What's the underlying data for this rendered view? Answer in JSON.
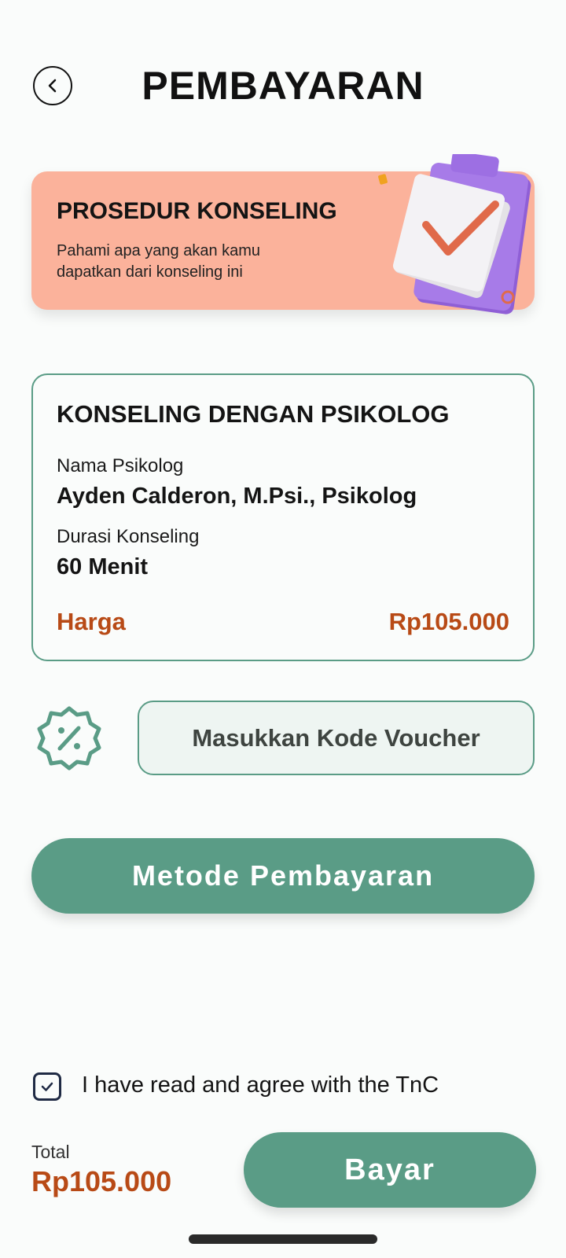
{
  "header": {
    "title": "PEMBAYARAN",
    "back_icon": "chevron-left-icon"
  },
  "banner": {
    "title": "PROSEDUR KONSELING",
    "subtitle": "Pahami apa yang akan kamu dapatkan dari konseling ini",
    "illustration": "clipboard-checklist-icon",
    "background": "#fbb29b"
  },
  "card": {
    "title": "KONSELING DENGAN PSIKOLOG",
    "psychologist_label": "Nama Psikolog",
    "psychologist_name": "Ayden Calderon, M.Psi., Psikolog",
    "duration_label": "Durasi Konseling",
    "duration_value": "60 Menit",
    "price_label": "Harga",
    "price_value": "Rp105.000",
    "border_color": "#5a9c86"
  },
  "voucher": {
    "icon": "discount-badge-icon",
    "placeholder": "Masukkan Kode Voucher"
  },
  "payment_method": {
    "label": "Metode Pembayaran"
  },
  "tnc": {
    "checked": true,
    "text": "I have read and agree with the TnC"
  },
  "footer": {
    "total_label": "Total",
    "total_value": "Rp105.000",
    "pay_label": "Bayar"
  },
  "colors": {
    "accent": "#5a9c86",
    "price": "#b84a16",
    "text": "#141414"
  }
}
